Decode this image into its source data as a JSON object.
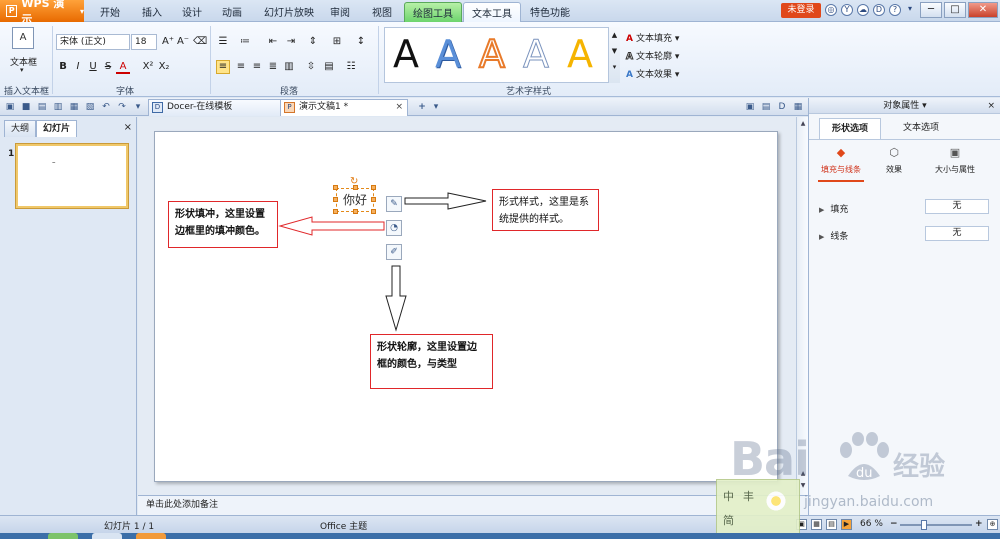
{
  "app": {
    "name": "WPS 演示"
  },
  "menu": {
    "items": [
      "开始",
      "插入",
      "设计",
      "动画",
      "幻灯片放映",
      "审阅",
      "视图"
    ],
    "context_tabs": [
      "绘图工具",
      "文本工具"
    ],
    "extra": "特色功能",
    "login": "未登录"
  },
  "window": {
    "min": "─",
    "max": "□",
    "close": "✕"
  },
  "ribbon": {
    "textbox": {
      "label": "文本框",
      "group": "插入文本框",
      "icon": "text-box-icon"
    },
    "font": {
      "name": "宋体 (正文)",
      "size": "18",
      "group": "字体",
      "buttons": [
        "B",
        "I",
        "U",
        "S",
        "A",
        "X²",
        "X₂"
      ],
      "grow": "A⁺",
      "shrink": "A⁻"
    },
    "paragraph": {
      "group": "段落"
    },
    "art": {
      "group": "艺术字样式",
      "styles": [
        "A",
        "A",
        "A",
        "A",
        "A"
      ]
    },
    "text_tools": [
      "文本填充",
      "文本轮廓",
      "文本效果"
    ]
  },
  "tabs": {
    "docs": [
      {
        "title": "Docer-在线模板"
      },
      {
        "title": "演示文稿1 *"
      }
    ],
    "add": "+"
  },
  "left_panel": {
    "tabs": [
      "大纲",
      "幻灯片"
    ],
    "close": "×",
    "slide_number": "1",
    "slide_mark": "–"
  },
  "slide": {
    "hello_text": "你好",
    "callouts": {
      "fill": "形状填冲，这里设置边框里的填冲颜色。",
      "style": "形式样式，这里是系统提供的样式。",
      "outline": "形状轮廓，这里设置边框的颜色，与类型"
    }
  },
  "notes_placeholder": "单击此处添加备注",
  "right_panel": {
    "title": "对象属性",
    "close": "×",
    "tabs": [
      "形状选项",
      "文本选项"
    ],
    "subtabs": [
      "填充与线条",
      "效果",
      "大小与属性"
    ],
    "rows": [
      {
        "label": "填充",
        "value": "无"
      },
      {
        "label": "线条",
        "value": "无"
      }
    ]
  },
  "status": {
    "slide_info": "幻灯片 1 / 1",
    "theme": "Office 主题",
    "zoom": "66 %",
    "zoom_minus": "−",
    "zoom_plus": "+"
  },
  "watermark": {
    "stamp_chars": [
      "中",
      "丰",
      "简"
    ],
    "logo": "Bai",
    "logo_tail": "du",
    "cn": "经验",
    "url": "jingyan.baidu.com"
  },
  "colors": {
    "accent": "#e86a00",
    "context_green": "#6dd46d",
    "callout_border": "#e0272a",
    "login_red": "#e0481a"
  }
}
